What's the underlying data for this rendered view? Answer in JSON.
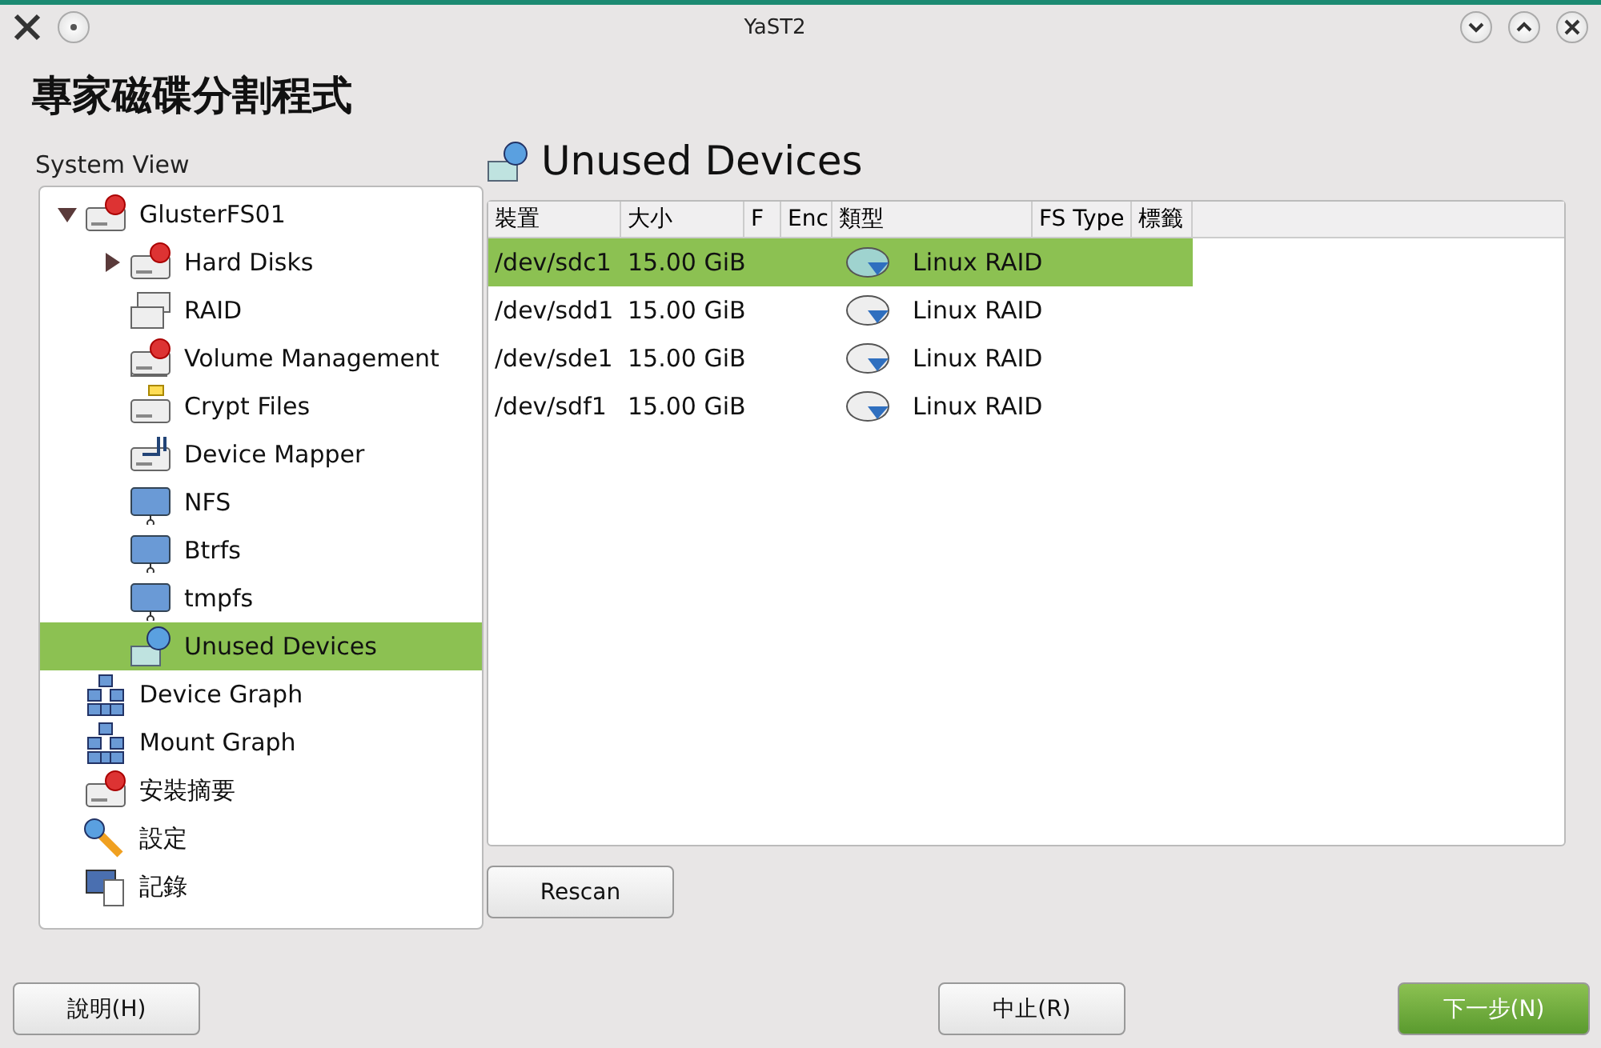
{
  "window": {
    "title": "YaST2"
  },
  "heading": "專家磁碟分割程式",
  "system_view": {
    "label": "System View",
    "tree": [
      {
        "label": "GlusterFS01",
        "kind": "disk",
        "expanded": true,
        "selected": false,
        "children": [
          {
            "label": "Hard Disks",
            "kind": "disk",
            "expanded": false,
            "selected": false
          },
          {
            "label": "RAID",
            "kind": "raid",
            "selected": false
          },
          {
            "label": "Volume Management",
            "kind": "volume",
            "selected": false
          },
          {
            "label": "Crypt Files",
            "kind": "crypt",
            "selected": false
          },
          {
            "label": "Device Mapper",
            "kind": "mapper",
            "selected": false
          },
          {
            "label": "NFS",
            "kind": "folder",
            "selected": false
          },
          {
            "label": "Btrfs",
            "kind": "folder",
            "selected": false
          },
          {
            "label": "tmpfs",
            "kind": "folder",
            "selected": false
          },
          {
            "label": "Unused Devices",
            "kind": "unused",
            "selected": true
          }
        ]
      },
      {
        "label": "Device Graph",
        "kind": "graph",
        "selected": false
      },
      {
        "label": "Mount Graph",
        "kind": "graph",
        "selected": false
      },
      {
        "label": "安裝摘要",
        "kind": "disk",
        "selected": false
      },
      {
        "label": "設定",
        "kind": "settings",
        "selected": false
      },
      {
        "label": "記錄",
        "kind": "log",
        "selected": false
      }
    ]
  },
  "panel": {
    "title": "Unused Devices",
    "table": {
      "columns": [
        "裝置",
        "大小",
        "F",
        "Enc",
        "類型",
        "FS Type",
        "標籤"
      ],
      "rows": [
        {
          "device": "/dev/sdc1",
          "size": "15.00 GiB",
          "type": "Linux RAID",
          "selected": true
        },
        {
          "device": "/dev/sdd1",
          "size": "15.00 GiB",
          "type": "Linux RAID",
          "selected": false
        },
        {
          "device": "/dev/sde1",
          "size": "15.00 GiB",
          "type": "Linux RAID",
          "selected": false
        },
        {
          "device": "/dev/sdf1",
          "size": "15.00 GiB",
          "type": "Linux RAID",
          "selected": false
        }
      ]
    },
    "rescan_button": "Rescan"
  },
  "buttons": [
    {
      "label": "說明(H)",
      "kind": "normal"
    },
    {
      "label": "中止(R)",
      "kind": "normal"
    },
    {
      "label": "下一步(N)",
      "kind": "primary"
    }
  ]
}
